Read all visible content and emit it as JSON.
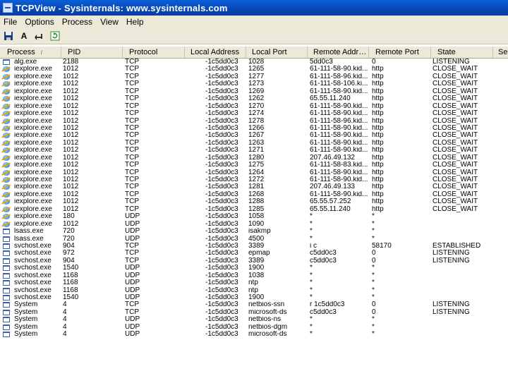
{
  "window": {
    "title": "TCPView - Sysinternals: www.sysinternals.com"
  },
  "menu": [
    "File",
    "Options",
    "Process",
    "View",
    "Help"
  ],
  "toolbar": {
    "buttons": [
      {
        "name": "save-icon",
        "glyph": "💾"
      },
      {
        "name": "font-icon",
        "glyph": "A"
      },
      {
        "name": "resolve-addresses-icon",
        "glyph": "⊸"
      },
      {
        "name": "refresh-icon",
        "glyph": "⟳"
      }
    ]
  },
  "columns": [
    "Process",
    "PID",
    "Protocol",
    "Local Address",
    "Local Port",
    "Remote Addr…",
    "Remote Port",
    "State",
    "Se"
  ],
  "sort_indicator": "/",
  "rows": [
    {
      "icon": "win",
      "process": "alg.exe",
      "pid": "2188",
      "protocol": "TCP",
      "local_address": "-1c5dd0c3",
      "local_port": "1028",
      "remote_address": "5dd0c3",
      "remote_port": "0",
      "state": "LISTENING"
    },
    {
      "icon": "ie",
      "process": "iexplore.exe",
      "pid": "1012",
      "protocol": "TCP",
      "local_address": "-1c5dd0c3",
      "local_port": "1265",
      "remote_address": "61-111-58-90.kid...",
      "remote_port": "http",
      "state": "CLOSE_WAIT"
    },
    {
      "icon": "ie",
      "process": "iexplore.exe",
      "pid": "1012",
      "protocol": "TCP",
      "local_address": "-1c5dd0c3",
      "local_port": "1277",
      "remote_address": "61-111-58-96.kid...",
      "remote_port": "http",
      "state": "CLOSE_WAIT"
    },
    {
      "icon": "ie",
      "process": "iexplore.exe",
      "pid": "1012",
      "protocol": "TCP",
      "local_address": "-1c5dd0c3",
      "local_port": "1273",
      "remote_address": "61-111-58-106.ki...",
      "remote_port": "http",
      "state": "CLOSE_WAIT"
    },
    {
      "icon": "ie",
      "process": "iexplore.exe",
      "pid": "1012",
      "protocol": "TCP",
      "local_address": "-1c5dd0c3",
      "local_port": "1269",
      "remote_address": "61-111-58-90.kid...",
      "remote_port": "http",
      "state": "CLOSE_WAIT"
    },
    {
      "icon": "ie",
      "process": "iexplore.exe",
      "pid": "1012",
      "protocol": "TCP",
      "local_address": "-1c5dd0c3",
      "local_port": "1262",
      "remote_address": "65.55.11.240",
      "remote_port": "http",
      "state": "CLOSE_WAIT"
    },
    {
      "icon": "ie",
      "process": "iexplore.exe",
      "pid": "1012",
      "protocol": "TCP",
      "local_address": "-1c5dd0c3",
      "local_port": "1270",
      "remote_address": "61-111-58-90.kid...",
      "remote_port": "http",
      "state": "CLOSE_WAIT"
    },
    {
      "icon": "ie",
      "process": "iexplore.exe",
      "pid": "1012",
      "protocol": "TCP",
      "local_address": "-1c5dd0c3",
      "local_port": "1274",
      "remote_address": "61-111-58-90.kid...",
      "remote_port": "http",
      "state": "CLOSE_WAIT"
    },
    {
      "icon": "ie",
      "process": "iexplore.exe",
      "pid": "1012",
      "protocol": "TCP",
      "local_address": "-1c5dd0c3",
      "local_port": "1278",
      "remote_address": "61-111-58-96.kid...",
      "remote_port": "http",
      "state": "CLOSE_WAIT"
    },
    {
      "icon": "ie",
      "process": "iexplore.exe",
      "pid": "1012",
      "protocol": "TCP",
      "local_address": "-1c5dd0c3",
      "local_port": "1266",
      "remote_address": "61-111-58-90.kid...",
      "remote_port": "http",
      "state": "CLOSE_WAIT"
    },
    {
      "icon": "ie",
      "process": "iexplore.exe",
      "pid": "1012",
      "protocol": "TCP",
      "local_address": "-1c5dd0c3",
      "local_port": "1267",
      "remote_address": "61-111-58-90.kid...",
      "remote_port": "http",
      "state": "CLOSE_WAIT"
    },
    {
      "icon": "ie",
      "process": "iexplore.exe",
      "pid": "1012",
      "protocol": "TCP",
      "local_address": "-1c5dd0c3",
      "local_port": "1263",
      "remote_address": "61-111-58-90.kid...",
      "remote_port": "http",
      "state": "CLOSE_WAIT"
    },
    {
      "icon": "ie",
      "process": "iexplore.exe",
      "pid": "1012",
      "protocol": "TCP",
      "local_address": "-1c5dd0c3",
      "local_port": "1271",
      "remote_address": "61-111-58-90.kid...",
      "remote_port": "http",
      "state": "CLOSE_WAIT"
    },
    {
      "icon": "ie",
      "process": "iexplore.exe",
      "pid": "1012",
      "protocol": "TCP",
      "local_address": "-1c5dd0c3",
      "local_port": "1280",
      "remote_address": "207.46.49.132",
      "remote_port": "http",
      "state": "CLOSE_WAIT"
    },
    {
      "icon": "ie",
      "process": "iexplore.exe",
      "pid": "1012",
      "protocol": "TCP",
      "local_address": "-1c5dd0c3",
      "local_port": "1275",
      "remote_address": "61-111-58-83.kid...",
      "remote_port": "http",
      "state": "CLOSE_WAIT"
    },
    {
      "icon": "ie",
      "process": "iexplore.exe",
      "pid": "1012",
      "protocol": "TCP",
      "local_address": "-1c5dd0c3",
      "local_port": "1264",
      "remote_address": "61-111-58-90.kid...",
      "remote_port": "http",
      "state": "CLOSE_WAIT"
    },
    {
      "icon": "ie",
      "process": "iexplore.exe",
      "pid": "1012",
      "protocol": "TCP",
      "local_address": "-1c5dd0c3",
      "local_port": "1272",
      "remote_address": "61-111-58-90.kid...",
      "remote_port": "http",
      "state": "CLOSE_WAIT"
    },
    {
      "icon": "ie",
      "process": "iexplore.exe",
      "pid": "1012",
      "protocol": "TCP",
      "local_address": "-1c5dd0c3",
      "local_port": "1281",
      "remote_address": "207.46.49.133",
      "remote_port": "http",
      "state": "CLOSE_WAIT"
    },
    {
      "icon": "ie",
      "process": "iexplore.exe",
      "pid": "1012",
      "protocol": "TCP",
      "local_address": "-1c5dd0c3",
      "local_port": "1268",
      "remote_address": "61-111-58-90.kid...",
      "remote_port": "http",
      "state": "CLOSE_WAIT"
    },
    {
      "icon": "ie",
      "process": "iexplore.exe",
      "pid": "1012",
      "protocol": "TCP",
      "local_address": "-1c5dd0c3",
      "local_port": "1288",
      "remote_address": "65.55.57.252",
      "remote_port": "http",
      "state": "CLOSE_WAIT"
    },
    {
      "icon": "ie",
      "process": "iexplore.exe",
      "pid": "1012",
      "protocol": "TCP",
      "local_address": "-1c5dd0c3",
      "local_port": "1285",
      "remote_address": "65.55.11.240",
      "remote_port": "http",
      "state": "CLOSE_WAIT"
    },
    {
      "icon": "ie",
      "process": "iexplore.exe",
      "pid": "180",
      "protocol": "UDP",
      "local_address": "-1c5dd0c3",
      "local_port": "1058",
      "remote_address": "*",
      "remote_port": "*",
      "state": ""
    },
    {
      "icon": "ie",
      "process": "iexplore.exe",
      "pid": "1012",
      "protocol": "UDP",
      "local_address": "-1c5dd0c3",
      "local_port": "1090",
      "remote_address": "*",
      "remote_port": "*",
      "state": ""
    },
    {
      "icon": "win",
      "process": "lsass.exe",
      "pid": "720",
      "protocol": "UDP",
      "local_address": "-1c5dd0c3",
      "local_port": "isakmp",
      "remote_address": "*",
      "remote_port": "*",
      "state": ""
    },
    {
      "icon": "win",
      "process": "lsass.exe",
      "pid": "720",
      "protocol": "UDP",
      "local_address": "-1c5dd0c3",
      "local_port": "4500",
      "remote_address": "*",
      "remote_port": "*",
      "state": ""
    },
    {
      "icon": "win",
      "process": "svchost.exe",
      "pid": "904",
      "protocol": "TCP",
      "local_address": "-1c5dd0c3",
      "local_port": "3389",
      "remote_address": "i            c",
      "remote_port": "58170",
      "state": "ESTABLISHED"
    },
    {
      "icon": "win",
      "process": "svchost.exe",
      "pid": "972",
      "protocol": "TCP",
      "local_address": "-1c5dd0c3",
      "local_port": "epmap",
      "remote_address": "c5dd0c3",
      "remote_port": "0",
      "state": "LISTENING"
    },
    {
      "icon": "win",
      "process": "svchost.exe",
      "pid": "904",
      "protocol": "TCP",
      "local_address": "-1c5dd0c3",
      "local_port": "3389",
      "remote_address": "c5dd0c3",
      "remote_port": "0",
      "state": "LISTENING"
    },
    {
      "icon": "win",
      "process": "svchost.exe",
      "pid": "1540",
      "protocol": "UDP",
      "local_address": "-1c5dd0c3",
      "local_port": "1900",
      "remote_address": "*",
      "remote_port": "*",
      "state": ""
    },
    {
      "icon": "win",
      "process": "svchost.exe",
      "pid": "1168",
      "protocol": "UDP",
      "local_address": "-1c5dd0c3",
      "local_port": "1038",
      "remote_address": "*",
      "remote_port": "*",
      "state": ""
    },
    {
      "icon": "win",
      "process": "svchost.exe",
      "pid": "1168",
      "protocol": "UDP",
      "local_address": "-1c5dd0c3",
      "local_port": "ntp",
      "remote_address": "*",
      "remote_port": "*",
      "state": ""
    },
    {
      "icon": "win",
      "process": "svchost.exe",
      "pid": "1168",
      "protocol": "UDP",
      "local_address": "-1c5dd0c3",
      "local_port": "ntp",
      "remote_address": "*",
      "remote_port": "*",
      "state": ""
    },
    {
      "icon": "win",
      "process": "svchost.exe",
      "pid": "1540",
      "protocol": "UDP",
      "local_address": "-1c5dd0c3",
      "local_port": "1900",
      "remote_address": "*",
      "remote_port": "*",
      "state": ""
    },
    {
      "icon": "win",
      "process": "System",
      "pid": "4",
      "protocol": "TCP",
      "local_address": "-1c5dd0c3",
      "local_port": "netbios-ssn",
      "remote_address": "r      1c5dd0c3",
      "remote_port": "0",
      "state": "LISTENING"
    },
    {
      "icon": "win",
      "process": "System",
      "pid": "4",
      "protocol": "TCP",
      "local_address": "-1c5dd0c3",
      "local_port": "microsoft-ds",
      "remote_address": "c5dd0c3",
      "remote_port": "0",
      "state": "LISTENING"
    },
    {
      "icon": "win",
      "process": "System",
      "pid": "4",
      "protocol": "UDP",
      "local_address": "-1c5dd0c3",
      "local_port": "netbios-ns",
      "remote_address": "*",
      "remote_port": "*",
      "state": ""
    },
    {
      "icon": "win",
      "process": "System",
      "pid": "4",
      "protocol": "UDP",
      "local_address": "-1c5dd0c3",
      "local_port": "netbios-dgm",
      "remote_address": "*",
      "remote_port": "*",
      "state": ""
    },
    {
      "icon": "win",
      "process": "System",
      "pid": "4",
      "protocol": "UDP",
      "local_address": "-1c5dd0c3",
      "local_port": "microsoft-ds",
      "remote_address": "*",
      "remote_port": "*",
      "state": ""
    }
  ]
}
